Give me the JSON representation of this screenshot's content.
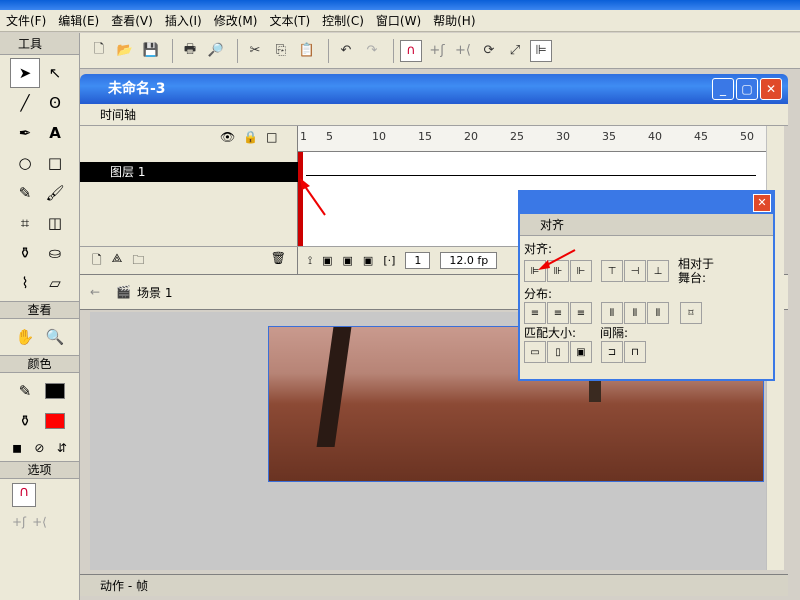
{
  "menu": [
    "文件(F)",
    "编辑(E)",
    "查看(V)",
    "插入(I)",
    "修改(M)",
    "文本(T)",
    "控制(C)",
    "窗口(W)",
    "帮助(H)"
  ],
  "tools_panel": {
    "title": "工具",
    "section_view": "查看",
    "section_colors": "颜色",
    "section_options": "选项"
  },
  "document": {
    "title": "未命名-3",
    "timeline_label": "时间轴",
    "layer_name": "图层 1",
    "ruler_ticks": [
      "1",
      "5",
      "10",
      "15",
      "20",
      "25",
      "30",
      "35",
      "40",
      "45",
      "50"
    ],
    "frame_number": "1",
    "fps": "12.0 fp",
    "scene": "场景 1",
    "actions_label": "动作 - 帧"
  },
  "align_panel": {
    "title": "对齐",
    "align_label": "对齐:",
    "distribute_label": "分布:",
    "match_size_label": "匹配大小:",
    "spacing_label": "间隔:",
    "relative_to_stage": "相对于舞台:"
  },
  "colors": {
    "titlebar": "#3a78e6",
    "stroke_color": "#000000",
    "fill_color": "#ff0000"
  }
}
